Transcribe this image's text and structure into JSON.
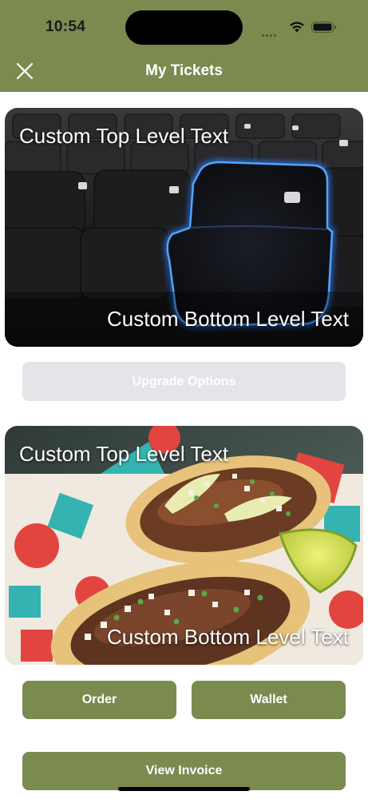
{
  "colors": {
    "accent": "#7b8b50",
    "upgrade_button_bg": "#e3e5e8",
    "text_on_accent": "#ffffff"
  },
  "status_bar": {
    "time": "10:54",
    "icons": [
      "signal-dots-icon",
      "wifi-icon",
      "battery-icon"
    ]
  },
  "header": {
    "title": "My Tickets",
    "close_icon": "close-icon"
  },
  "tickets": [
    {
      "top_text": "Custom Top Level Text",
      "bottom_text": "Custom Bottom Level Text",
      "image": "stadium seats with highlighted blue seat"
    },
    {
      "top_text": "Custom Top Level Text",
      "bottom_text": "Custom Bottom Level Text",
      "image": "tacos with lime"
    }
  ],
  "buttons": {
    "upgrade": "Upgrade Options",
    "order": "Order",
    "wallet": "Wallet",
    "view_invoice": "View Invoice"
  }
}
